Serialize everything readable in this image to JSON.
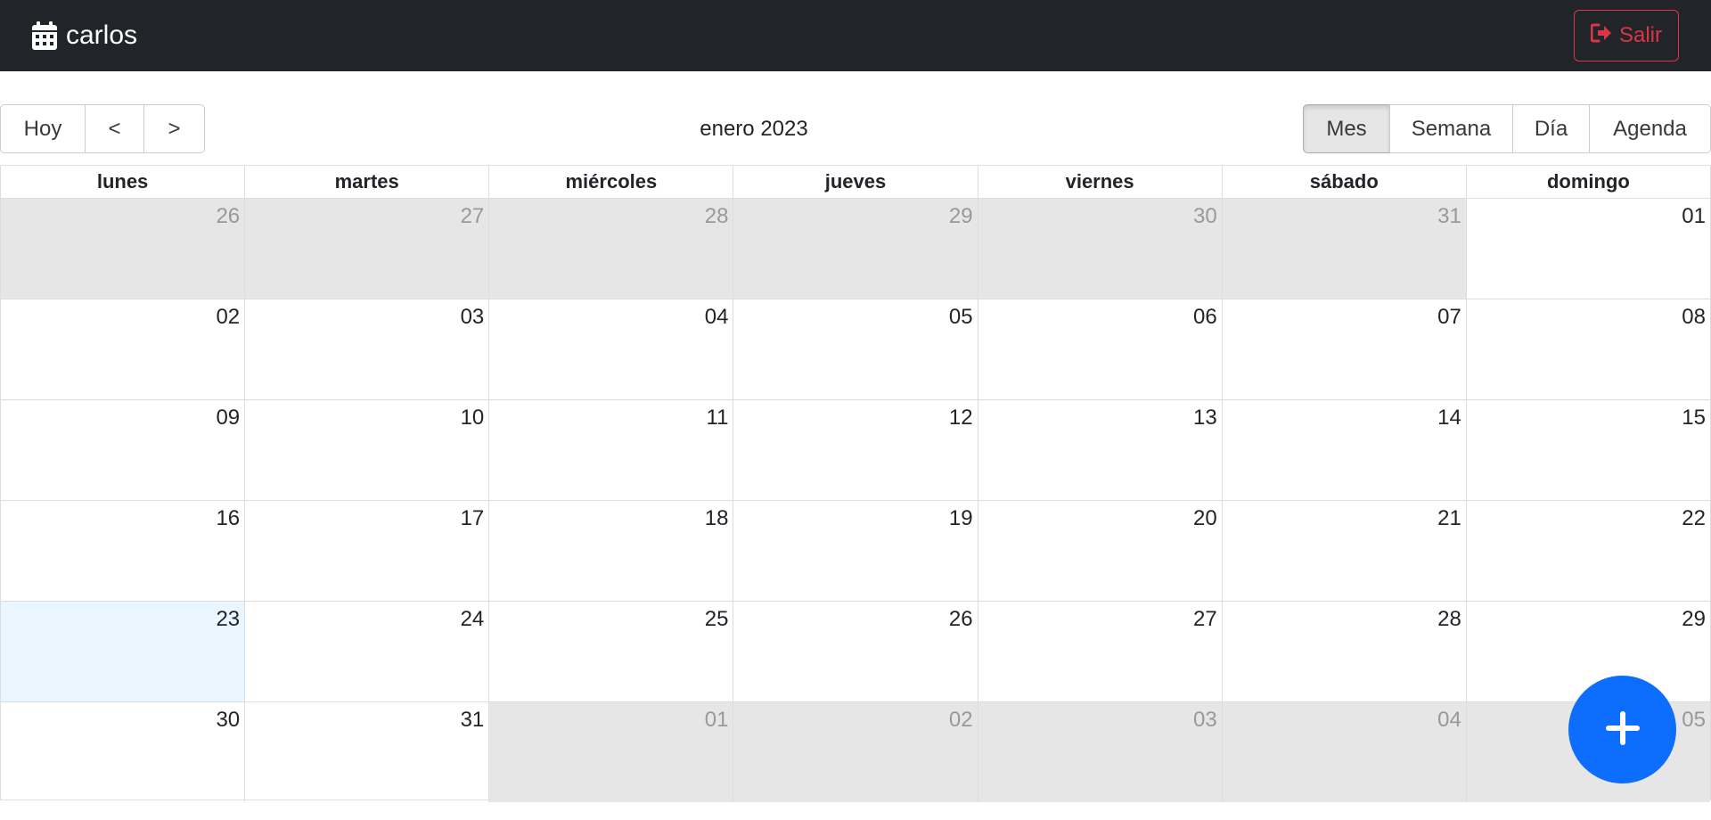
{
  "navbar": {
    "brand_icon": "calendar-icon",
    "brand_text": "carlos",
    "logout_icon": "sign-out-icon",
    "logout_label": "Salir",
    "logout_color": "#dc3545"
  },
  "toolbar": {
    "today_label": "Hoy",
    "prev_label": "<",
    "next_label": ">",
    "current_label": "enero 2023",
    "views": [
      {
        "label": "Mes",
        "active": true
      },
      {
        "label": "Semana",
        "active": false
      },
      {
        "label": "Día",
        "active": false
      },
      {
        "label": "Agenda",
        "active": false
      }
    ]
  },
  "month": {
    "headers": [
      "lunes",
      "martes",
      "miércoles",
      "jueves",
      "viernes",
      "sábado",
      "domingo"
    ],
    "weeks": [
      [
        {
          "d": "26",
          "off": true
        },
        {
          "d": "27",
          "off": true
        },
        {
          "d": "28",
          "off": true
        },
        {
          "d": "29",
          "off": true
        },
        {
          "d": "30",
          "off": true
        },
        {
          "d": "31",
          "off": true
        },
        {
          "d": "01"
        }
      ],
      [
        {
          "d": "02"
        },
        {
          "d": "03"
        },
        {
          "d": "04"
        },
        {
          "d": "05"
        },
        {
          "d": "06"
        },
        {
          "d": "07"
        },
        {
          "d": "08"
        }
      ],
      [
        {
          "d": "09"
        },
        {
          "d": "10"
        },
        {
          "d": "11"
        },
        {
          "d": "12"
        },
        {
          "d": "13"
        },
        {
          "d": "14"
        },
        {
          "d": "15"
        }
      ],
      [
        {
          "d": "16"
        },
        {
          "d": "17"
        },
        {
          "d": "18"
        },
        {
          "d": "19"
        },
        {
          "d": "20"
        },
        {
          "d": "21"
        },
        {
          "d": "22"
        }
      ],
      [
        {
          "d": "23",
          "today": true
        },
        {
          "d": "24"
        },
        {
          "d": "25"
        },
        {
          "d": "26"
        },
        {
          "d": "27"
        },
        {
          "d": "28"
        },
        {
          "d": "29"
        }
      ],
      [
        {
          "d": "30"
        },
        {
          "d": "31"
        },
        {
          "d": "01",
          "off": true
        },
        {
          "d": "02",
          "off": true
        },
        {
          "d": "03",
          "off": true
        },
        {
          "d": "04",
          "off": true
        },
        {
          "d": "05",
          "off": true
        }
      ]
    ]
  },
  "fab": {
    "icon": "plus-icon",
    "color": "#0d6efd"
  }
}
